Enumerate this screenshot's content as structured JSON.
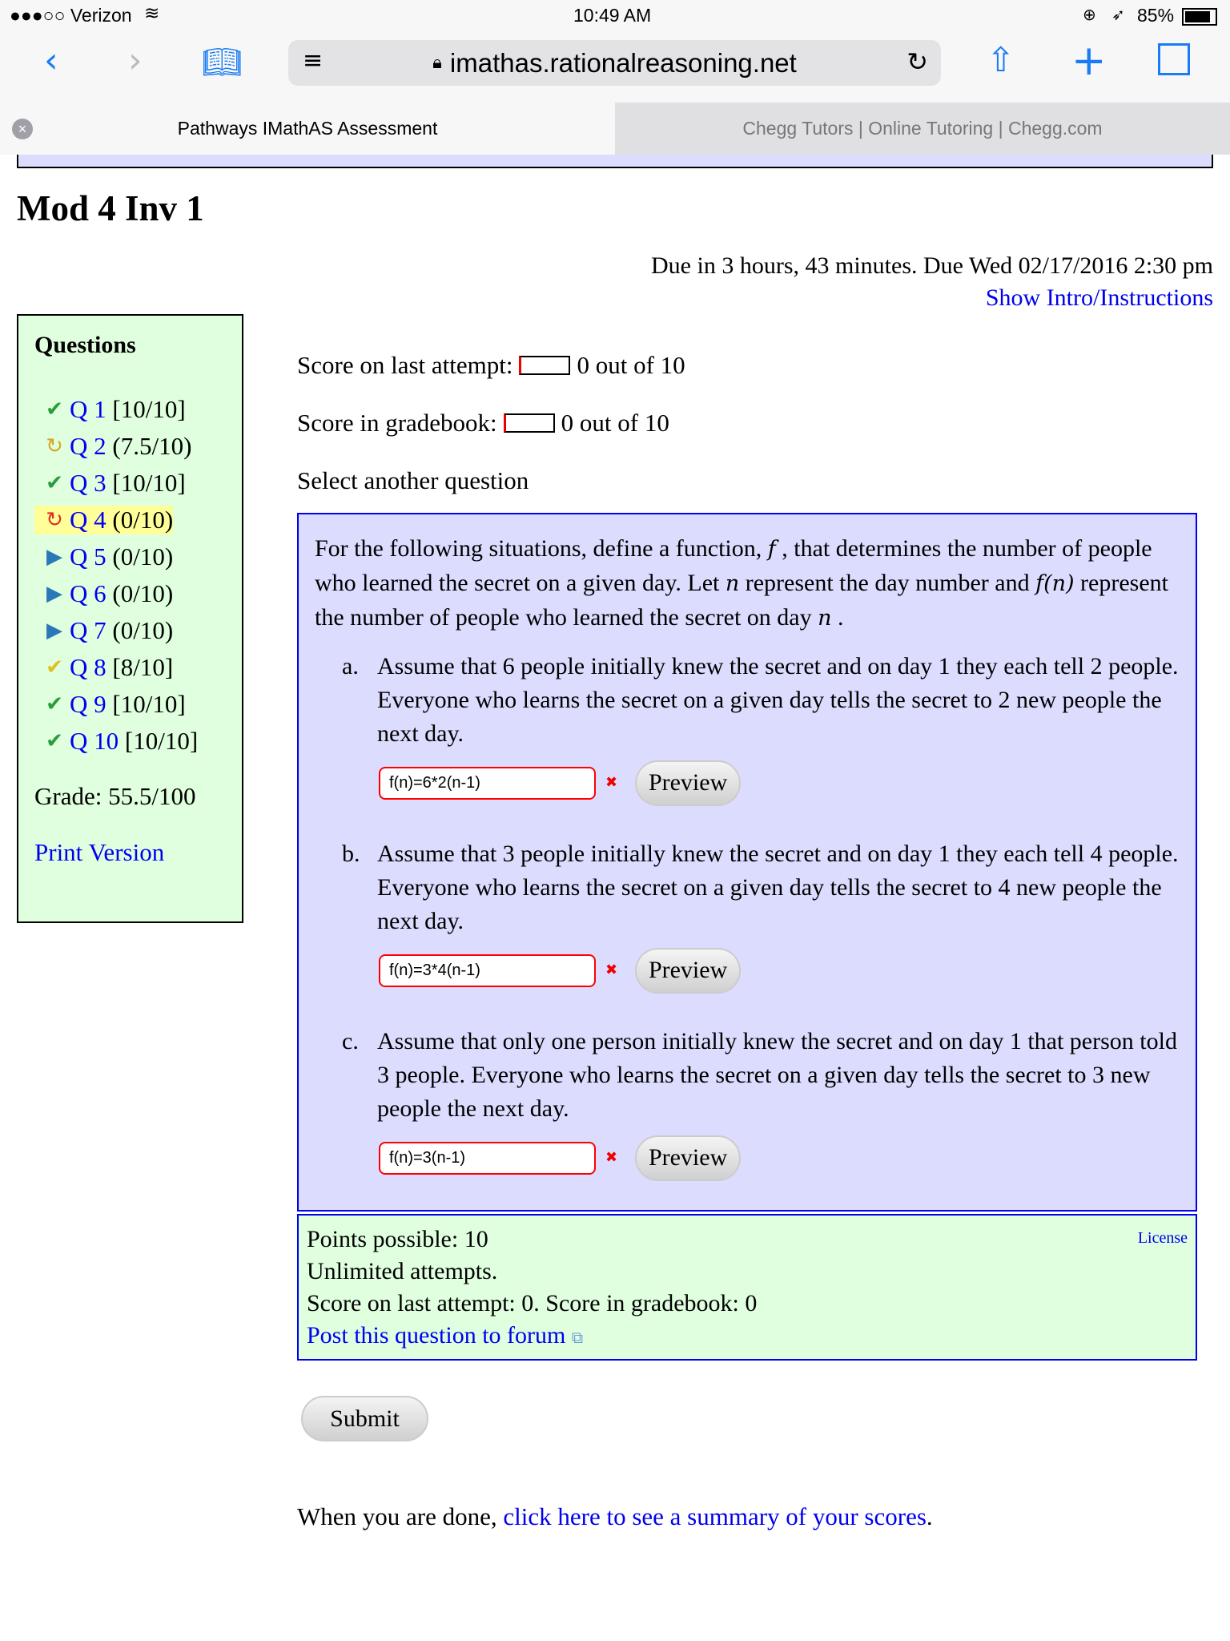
{
  "status": {
    "carrier": "●●●○○ Verizon",
    "time": "10:49 AM",
    "battery": "85%"
  },
  "browser": {
    "url": "imathas.rationalreasoning.net",
    "tabs": [
      {
        "label": "Pathways IMathAS Assessment",
        "active": true
      },
      {
        "label": "Chegg Tutors | Online Tutoring | Chegg.com",
        "active": false
      }
    ]
  },
  "page": {
    "title": "Mod 4 Inv 1",
    "due": "Due in 3 hours, 43 minutes. Due Wed 02/17/2016 2:30 pm",
    "intro_link": "Show Intro/Instructions"
  },
  "sidebar": {
    "heading": "Questions",
    "questions": [
      {
        "label": "Q 1",
        "score": "[10/10]",
        "status": "correct"
      },
      {
        "label": "Q 2",
        "score": "(7.5/10)",
        "status": "retry-partial"
      },
      {
        "label": "Q 3",
        "score": "[10/10]",
        "status": "correct"
      },
      {
        "label": "Q 4",
        "score": "(0/10)",
        "status": "retry-current"
      },
      {
        "label": "Q 5",
        "score": "(0/10)",
        "status": "unattempted"
      },
      {
        "label": "Q 6",
        "score": "(0/10)",
        "status": "unattempted"
      },
      {
        "label": "Q 7",
        "score": "(0/10)",
        "status": "unattempted"
      },
      {
        "label": "Q 8",
        "score": "[8/10]",
        "status": "partial"
      },
      {
        "label": "Q 9",
        "score": "[10/10]",
        "status": "correct"
      },
      {
        "label": "Q 10",
        "score": "[10/10]",
        "status": "correct"
      }
    ],
    "grade": "Grade: 55.5/100",
    "print": "Print Version"
  },
  "main": {
    "last_attempt_label": "Score on last attempt:",
    "last_attempt_value": "0 out of 10",
    "gradebook_label": "Score in gradebook:",
    "gradebook_value": "0 out of 10",
    "select_another": "Select another question"
  },
  "question": {
    "intro_1": "For the following situations, define a function, ",
    "f": "f",
    "intro_2": " , that determines the number of people who learned the secret on a given day. Let ",
    "n": "n",
    "intro_3": "  represent the day number and ",
    "fn": "f(n)",
    "intro_4": "  represent the number of people who learned the secret on day ",
    "n2": "n",
    "intro_5": " .",
    "parts": [
      {
        "label": "a.",
        "text": "Assume that 6 people initially knew the secret and on day 1 they each tell 2 people.  Everyone who learns the secret on a given day tells the secret to 2 new people the next day.",
        "answer": "f(n)=6*2(n-1)"
      },
      {
        "label": "b.",
        "text": "Assume that 3 people initially knew the secret and on day 1 they each tell 4 people.  Everyone who learns the secret on a given day tells the secret to 4 new people the next day.",
        "answer": "f(n)=3*4(n-1)"
      },
      {
        "label": "c.",
        "text": "Assume that only one person initially knew the secret and on day 1 that person told 3 people.  Everyone who learns the secret on a given day tells the secret to 3 new people the next day.",
        "answer": "f(n)=3(n-1)"
      }
    ],
    "preview_label": "Preview"
  },
  "info": {
    "points": "Points possible: 10",
    "attempts": "Unlimited attempts.",
    "scores": "Score on last attempt: 0. Score in gradebook: 0",
    "forum": "Post this question to forum",
    "license": "License"
  },
  "submit_label": "Submit",
  "final": {
    "prefix": "When you are done, ",
    "link": "click here to see a summary of your scores",
    "suffix": "."
  },
  "colors": {
    "link": "#0000ee",
    "sidebar_bg": "#dfffdf",
    "question_bg": "#dcdcff",
    "error": "#ff0000"
  }
}
